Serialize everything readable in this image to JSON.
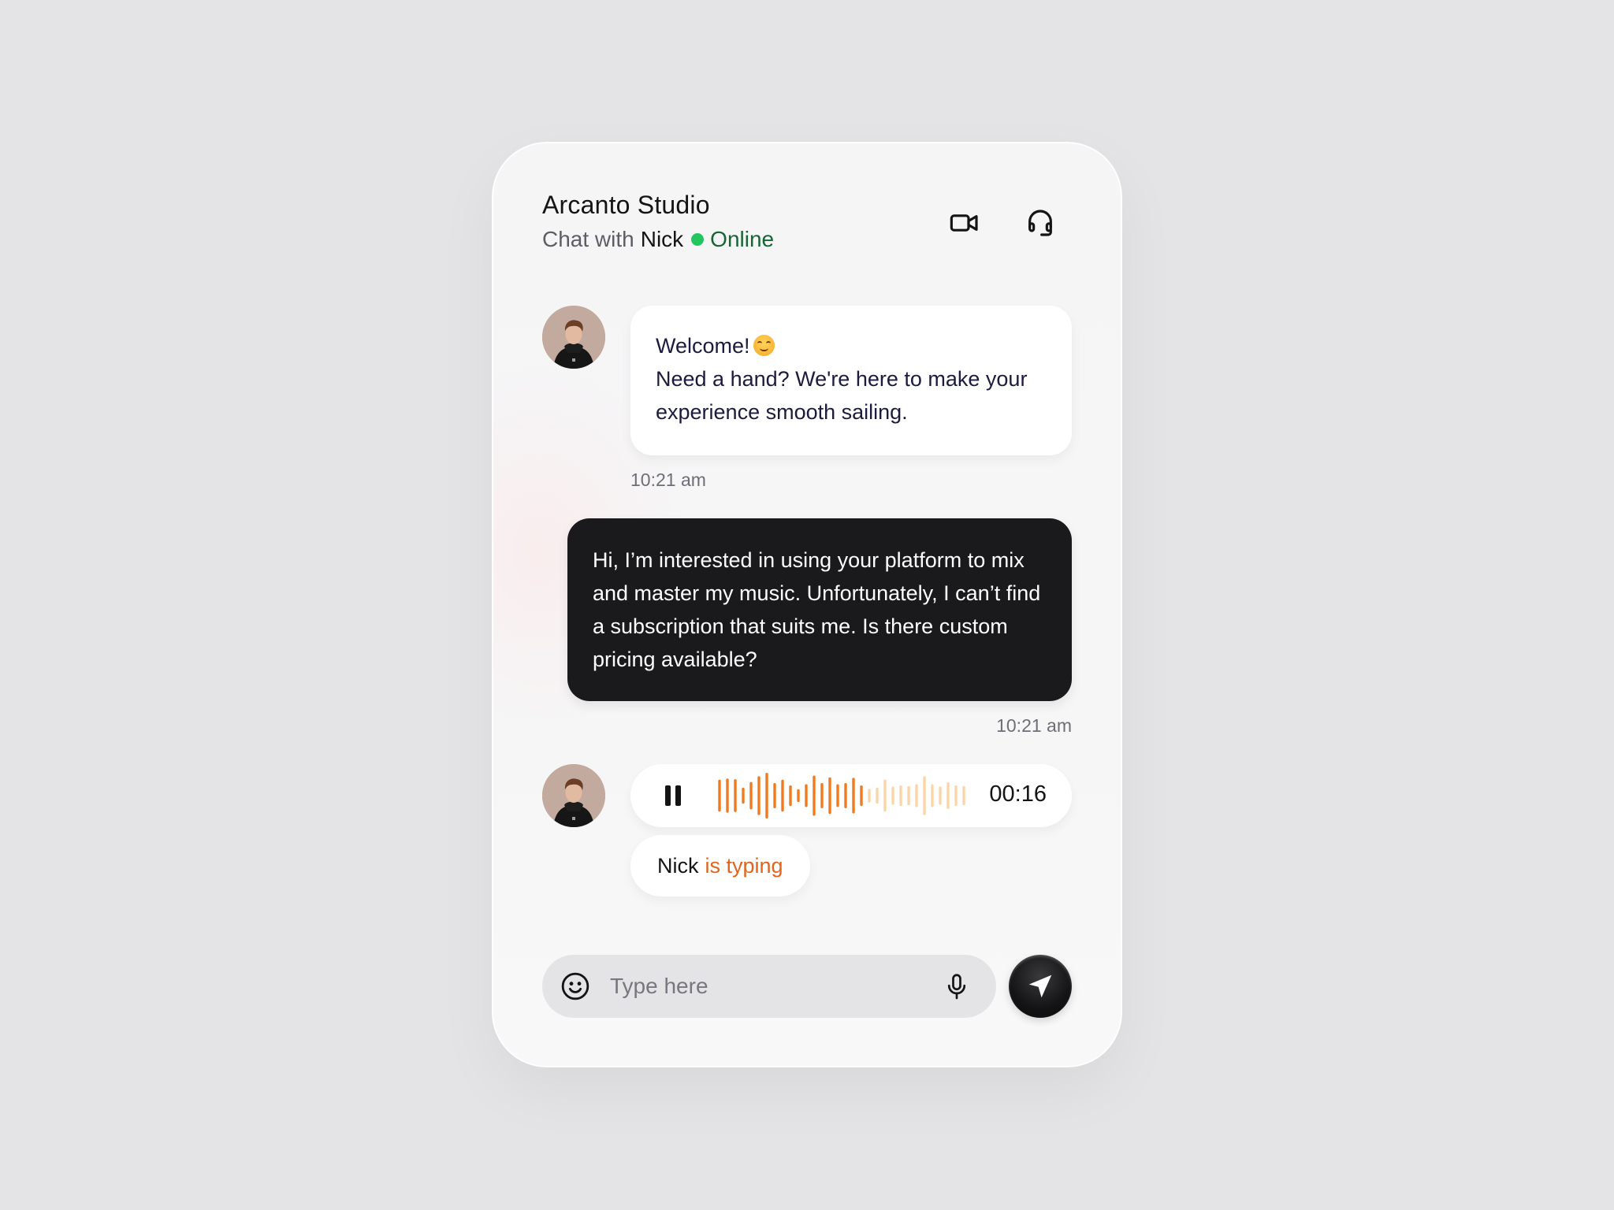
{
  "header": {
    "title": "Arcanto Studio",
    "subtitle_prefix": "Chat with",
    "contact_name": "Nick",
    "status": "Online",
    "status_color": "#22c55e",
    "actions": [
      {
        "icon": "video-camera-icon",
        "label": "Video call"
      },
      {
        "icon": "headset-icon",
        "label": "Support"
      }
    ]
  },
  "messages": [
    {
      "from": "Nick",
      "type": "text",
      "line1": "Welcome!",
      "emoji": "smiling-face-emoji",
      "body": "Need a hand? We're here to make your experience smooth sailing.",
      "time": "10:21 am"
    },
    {
      "from": "me",
      "type": "text",
      "body": "Hi, I’m interested in using your platform to mix and master my music. Unfortunately, I can’t find a subscription that suits me. Is there custom pricing available?",
      "time": "10:21 am"
    },
    {
      "from": "Nick",
      "type": "voice",
      "state": "playing",
      "duration": "00:16",
      "progress": 0.59,
      "waveform": [
        0.7,
        0.75,
        0.72,
        0.35,
        0.6,
        0.85,
        1.0,
        0.55,
        0.7,
        0.45,
        0.28,
        0.5,
        0.88,
        0.55,
        0.8,
        0.5,
        0.55,
        0.78,
        0.45,
        0.3,
        0.35,
        0.7,
        0.4,
        0.45,
        0.42,
        0.5,
        0.85,
        0.5,
        0.4,
        0.58,
        0.45,
        0.42
      ],
      "played_color": "#f07a1f",
      "unplayed_color": "#fbd5a8"
    }
  ],
  "typing_indicator": {
    "name": "Nick",
    "status": "is typing"
  },
  "composer": {
    "placeholder": "Type here",
    "value": "",
    "emoji_icon": "smiley-icon",
    "mic_icon": "microphone-icon",
    "send_icon": "send-arrow-icon"
  }
}
